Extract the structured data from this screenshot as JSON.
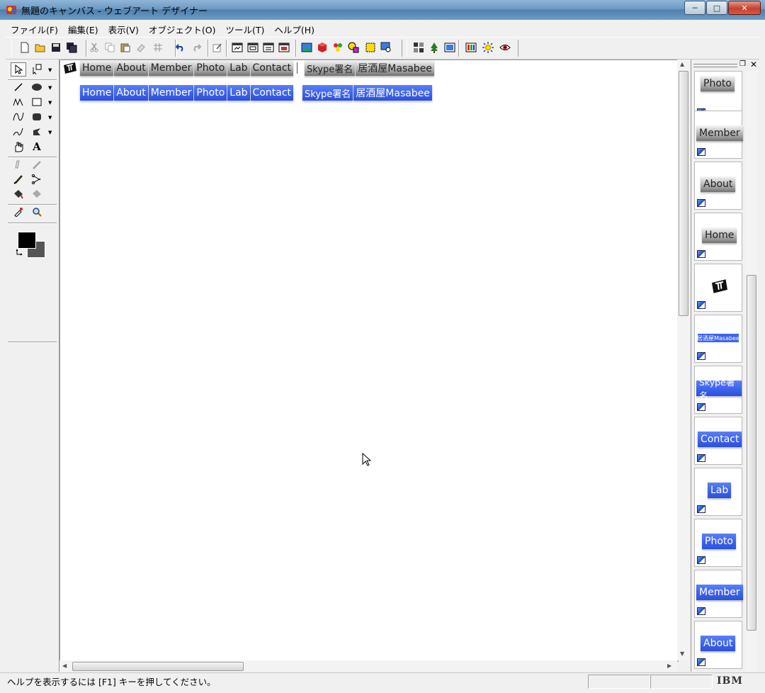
{
  "window": {
    "title": "無題のキャンバス - ウェブアート デザイナー",
    "controls": [
      "─",
      "□",
      "✕"
    ]
  },
  "menu": [
    "ファイル(F)",
    "編集(E)",
    "表示(V)",
    "オブジェクト(O)",
    "ツール(T)",
    "ヘルプ(H)"
  ],
  "toolbar_icons": [
    "new-file-icon",
    "open-folder-icon",
    "save-icon",
    "save-as-icon",
    "cut-icon",
    "copy-icon",
    "paste-icon",
    "clear-icon",
    "grid-icon",
    "undo-icon",
    "redo-icon",
    "edit-icon",
    "frame1-icon",
    "frame2-icon",
    "frame3-icon",
    "frame4-icon",
    "image-icon",
    "cube-icon",
    "palette-icon",
    "shapes-icon",
    "select-box-icon",
    "zoom-image-icon",
    "arrange-icon",
    "tree-icon",
    "picture-icon",
    "color-bars-icon",
    "sun-icon",
    "eye-icon"
  ],
  "tools_icons": [
    "arrow-select-icon",
    "group-select-icon",
    "line-icon",
    "ellipse-icon",
    "polyline-icon",
    "rectangle-icon",
    "curve-icon",
    "rounded-rect-icon",
    "freehand-icon",
    "shape-arc-icon",
    "hand-icon",
    "text-icon",
    "eraser-icon",
    "pencil-icon",
    "brush-icon",
    "scissors-icon",
    "fill-icon",
    "pattern-icon",
    "dropper-icon",
    "zoom-icon"
  ],
  "nav_gray": {
    "items": [
      "Home",
      "About",
      "Member",
      "Photo",
      "Lab",
      "Contact",
      "Skype署名",
      "居酒屋Masabee"
    ]
  },
  "nav_blue": {
    "items": [
      "Home",
      "About",
      "Member",
      "Photo",
      "Lab",
      "Contact",
      "Skype署名",
      "居酒屋Masabee"
    ]
  },
  "gallery": [
    {
      "label": "Photo",
      "style": "gray"
    },
    {
      "label": "Member",
      "style": "gray"
    },
    {
      "label": "About",
      "style": "gray"
    },
    {
      "label": "Home",
      "style": "gray"
    },
    {
      "label": "",
      "style": "logo"
    },
    {
      "label": "居酒屋Masabee",
      "style": "mini"
    },
    {
      "label": "Skype署名",
      "style": "blue"
    },
    {
      "label": "Contact",
      "style": "blue"
    },
    {
      "label": "Lab",
      "style": "blue"
    },
    {
      "label": "Photo",
      "style": "blue"
    },
    {
      "label": "Member",
      "style": "blue"
    },
    {
      "label": "About",
      "style": "blue"
    }
  ],
  "status": {
    "help": "ヘルプを表示するには [F1] キーを押してください。",
    "brand": "IBM"
  },
  "colors": {
    "foreground": "#000000",
    "background": "#555555",
    "nav_blue": "#3d63ee"
  }
}
